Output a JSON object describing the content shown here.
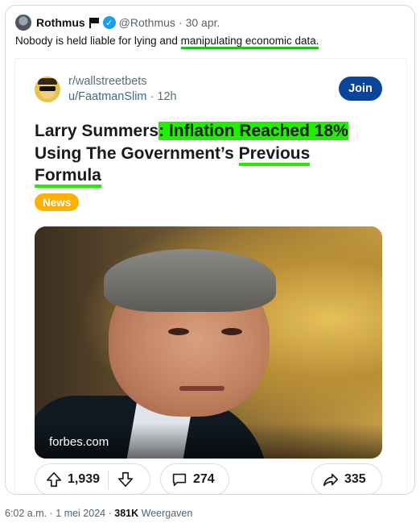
{
  "tweet": {
    "author_name": "Rothmus",
    "author_handle": "@Rothmus",
    "separator": "·",
    "date": "30 apr.",
    "text_before": "Nobody is held liable for lying and ",
    "text_highlighted": "manipulating economic data.",
    "highlight_color": "#22c01f"
  },
  "embed": {
    "subreddit": "r/wallstreetbets",
    "username": "u/FaatmanSlim",
    "age": "12h",
    "join_label": "Join",
    "join_color": "#0a449b",
    "headline_part1": "Larry Summers",
    "headline_part2": ": Inflation Reached 18%",
    "headline_part3": "Using The Government’s ",
    "headline_part4": "Previous",
    "headline_part5": "Formula",
    "headline_highlight_color": "#22ee00",
    "flair": "News",
    "flair_color": "#ffb000",
    "image_source": "forbes.com",
    "upvotes": "1,939",
    "comments": "274",
    "shares": "335"
  },
  "footer": {
    "time": "6:02 a.m.",
    "separator": "·",
    "date": "1 mei 2024",
    "views_count": "381K",
    "views_label": " Weergaven"
  },
  "icons": [
    "flag-icon",
    "verified-badge-icon",
    "upvote-arrow-icon",
    "downvote-arrow-icon",
    "comment-bubble-icon",
    "share-arrow-icon"
  ]
}
